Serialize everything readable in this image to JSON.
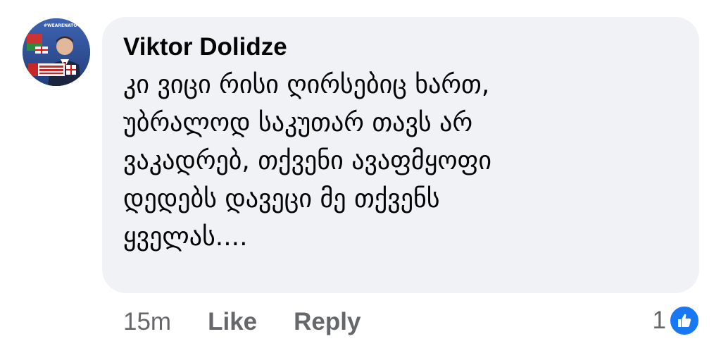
{
  "comment": {
    "author": "Viktor Dolidze",
    "text": "კი ვიცი რისი ღირსებიც ხართ,\nუბრალოდ საკუთარ თავს არ\nვაკადრებ, თქვენი ავაფმყოფი\nდედებს დავეცი მე თქვენს\nყველას....",
    "avatar_caption": "#WEARENATO",
    "time": "15m",
    "like_label": "Like",
    "reply_label": "Reply",
    "reaction_count": "1",
    "reaction_icon": "thumbs-up-icon"
  },
  "colors": {
    "bubble_bg": "#f0f2f5",
    "author_text": "#050505",
    "meta_text": "#65676b",
    "like_blue": "#1877f2"
  }
}
